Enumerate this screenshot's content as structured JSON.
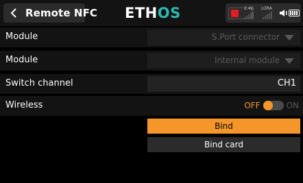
{
  "header": {
    "title": "Remote NFC",
    "logo_left": "ETH",
    "logo_right": "OS",
    "logo_accent": "#2bb9b1"
  },
  "status": {
    "rssi1_label": "2.4G",
    "rssi2_label": "LORA"
  },
  "rows": [
    {
      "label": "Module",
      "value": "S.Port connector"
    },
    {
      "label": "Module",
      "value": "Internal module"
    },
    {
      "label": "Switch channel",
      "value": "CH1"
    },
    {
      "label": "Wireless",
      "off_label": "OFF",
      "on_label": "ON"
    }
  ],
  "buttons": {
    "bind": "Bind",
    "bind_card": "Bind card"
  },
  "colors": {
    "accent": "#f4962a",
    "header_bg": "#131313",
    "field_bg": "#1e1e1e"
  }
}
